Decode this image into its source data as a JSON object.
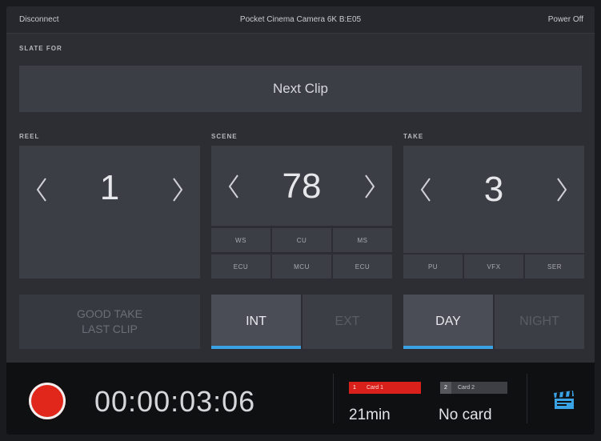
{
  "topbar": {
    "disconnect": "Disconnect",
    "camera": "Pocket Cinema Camera 6K B:E05",
    "power": "Power Off"
  },
  "slate_for": {
    "label": "SLATE FOR",
    "value": "Next Clip"
  },
  "reel": {
    "label": "REEL",
    "value": "1"
  },
  "scene": {
    "label": "SCENE",
    "value": "78",
    "shots": [
      "WS",
      "CU",
      "MS",
      "ECU",
      "MCU",
      "ECU"
    ]
  },
  "take": {
    "label": "TAKE",
    "value": "3",
    "types": [
      "PU",
      "VFX",
      "SER"
    ]
  },
  "good_take": {
    "line1": "GOOD TAKE",
    "line2": "LAST CLIP"
  },
  "int_ext": {
    "int": "INT",
    "ext": "EXT",
    "selected": "INT"
  },
  "day_night": {
    "day": "DAY",
    "night": "NIGHT",
    "selected": "DAY"
  },
  "status": {
    "timecode": "00:00:03:06",
    "card1": {
      "number": "1",
      "name": "Card 1",
      "value": "21min",
      "color": "#d9201b"
    },
    "card2": {
      "number": "2",
      "name": "Card 2",
      "value": "No card",
      "color": "#3d3f45"
    }
  },
  "colors": {
    "accent": "#3aa3e6",
    "record": "#e1261c"
  },
  "icons": {
    "prev": "chevron-left-icon",
    "next": "chevron-right-icon",
    "slate": "clapperboard-icon"
  }
}
